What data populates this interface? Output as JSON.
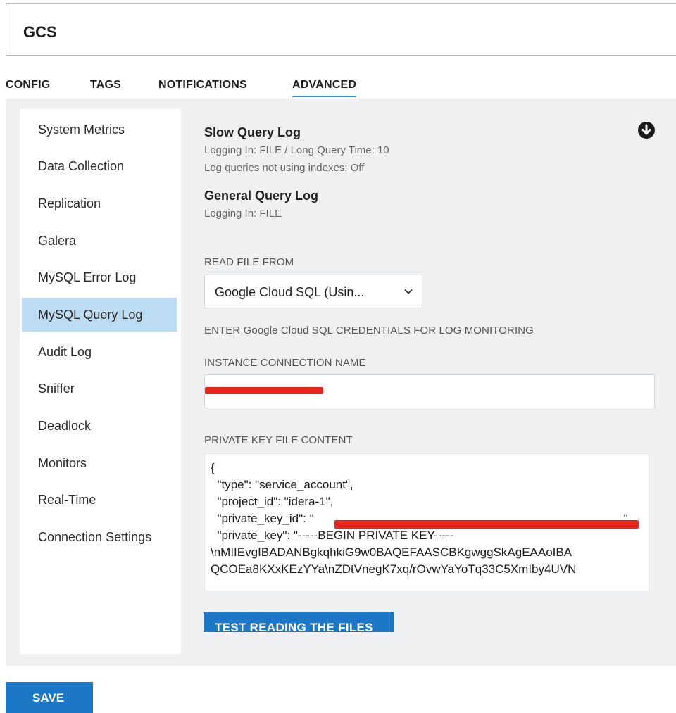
{
  "header": {
    "name_value": "GCS"
  },
  "tabs": [
    {
      "label": "CONFIG",
      "active": false
    },
    {
      "label": "TAGS",
      "active": false
    },
    {
      "label": "NOTIFICATIONS",
      "active": false
    },
    {
      "label": "ADVANCED",
      "active": true
    }
  ],
  "colors": {
    "accent": "#29a3da",
    "button": "#1c78c7",
    "sidebar_active": "#bcdcf3",
    "panel_bg": "#eef0f2",
    "redaction": "#e8251b"
  },
  "sidebar": {
    "items": [
      {
        "label": "System Metrics"
      },
      {
        "label": "Data Collection"
      },
      {
        "label": "Replication"
      },
      {
        "label": "Galera"
      },
      {
        "label": "MySQL Error Log"
      },
      {
        "label": "MySQL Query Log",
        "active": true
      },
      {
        "label": "Audit Log"
      },
      {
        "label": "Sniffer"
      },
      {
        "label": "Deadlock"
      },
      {
        "label": "Monitors"
      },
      {
        "label": "Real-Time"
      },
      {
        "label": "Connection Settings"
      }
    ]
  },
  "slow_log": {
    "title": "Slow Query Log",
    "line1": "Logging In: FILE / Long Query Time: 10",
    "line2": "Log queries not using indexes: Off"
  },
  "general_log": {
    "title": "General Query Log",
    "line1": "Logging In: FILE"
  },
  "download_icon": "arrow-down-circle-icon",
  "read_from": {
    "label": "READ FILE FROM",
    "selected": "Google Cloud SQL (Usin..."
  },
  "credentials_heading": "ENTER Google Cloud SQL CREDENTIALS FOR LOG MONITORING",
  "instance": {
    "label": "INSTANCE CONNECTION NAME"
  },
  "private_key": {
    "label": "PRIVATE KEY FILE CONTENT",
    "line1": "{",
    "line2": "  \"type\": \"service_account\",",
    "line3": "  \"project_id\": \"idera-1\",",
    "line4a": "  \"private_key_id\": \"",
    "line4b": "\",",
    "line5": "  \"private_key\": \"-----BEGIN PRIVATE KEY-----",
    "line6": "\\nMIIEvgIBADANBgkqhkiG9w0BAQEFAASCBKgwggSkAgEAAoIBA",
    "line7": "QCOEa8KXxKEzYYa\\nZDtVnegK7xq/rOvwYaYoTq33C5XmIby4UVN"
  },
  "buttons": {
    "test": "TEST READING THE FILES",
    "save": "SAVE"
  }
}
